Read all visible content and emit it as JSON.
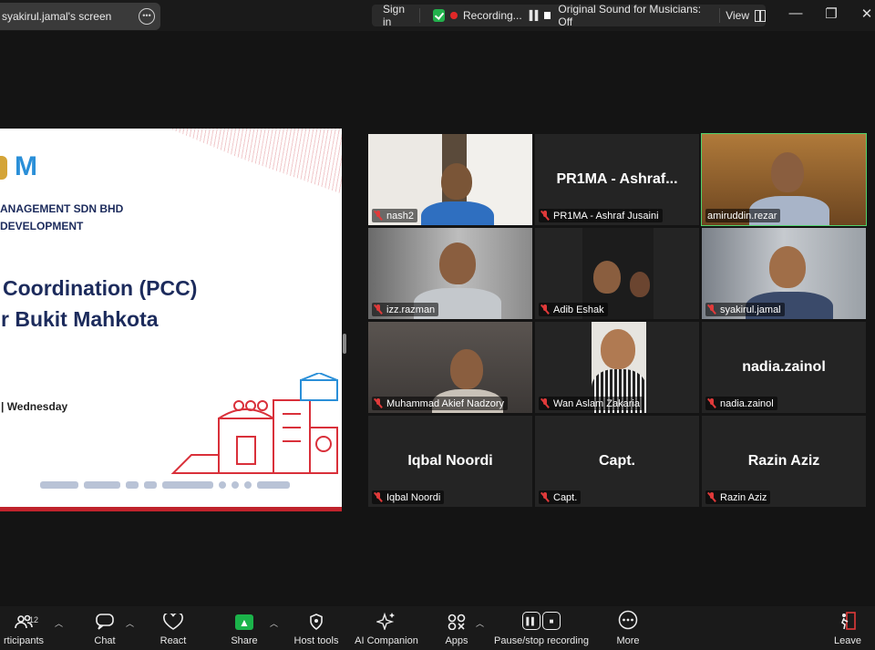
{
  "top": {
    "share_label": "syakirul.jamal's screen",
    "sign_in": "Sign in",
    "recording": "Recording...",
    "original_sound": "Original Sound for Musicians: Off",
    "view": "View"
  },
  "slide": {
    "line1": "ANAGEMENT SDN BHD",
    "line2": "DEVELOPMENT",
    "title1": "Coordination (PCC)",
    "title2": "r Bukit Mahkota",
    "date": "| Wednesday"
  },
  "tiles": [
    {
      "label": "nash2",
      "name": ""
    },
    {
      "label": "PR1MA - Ashraf Jusaini",
      "name": "PR1MA - Ashraf..."
    },
    {
      "label": "amiruddin.rezar",
      "name": ""
    },
    {
      "label": "izz.razman",
      "name": ""
    },
    {
      "label": "Adib Eshak",
      "name": ""
    },
    {
      "label": "syakirul.jamal",
      "name": ""
    },
    {
      "label": "Muhammad Akief Nadzory",
      "name": ""
    },
    {
      "label": "Wan Aslam Zakaria",
      "name": ""
    },
    {
      "label": "nadia.zainol",
      "name": "nadia.zainol"
    },
    {
      "label": "Iqbal Noordi",
      "name": "Iqbal Noordi"
    },
    {
      "label": "Capt.",
      "name": "Capt."
    },
    {
      "label": "Razin Aziz",
      "name": "Razin Aziz"
    }
  ],
  "toolbar": {
    "participants_count": "12",
    "participants": "rticipants",
    "chat": "Chat",
    "react": "React",
    "share": "Share",
    "host_tools": "Host tools",
    "ai_companion": "AI Companion",
    "apps": "Apps",
    "record": "Pause/stop recording",
    "more": "More",
    "leave": "Leave"
  },
  "colors": {
    "active_speaker": "#4fd16b",
    "share_green": "#1bb34a",
    "slide_red": "#c0232c"
  }
}
